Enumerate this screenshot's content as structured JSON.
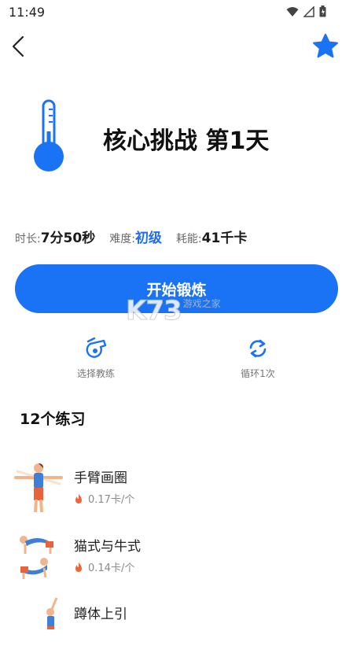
{
  "status_bar": {
    "time": "11:49",
    "icons": [
      "wifi-icon",
      "signal-icon",
      "battery-icon"
    ]
  },
  "header": {
    "back_icon": "chevron-left-icon",
    "favorite_icon": "star-icon"
  },
  "workout": {
    "title": "核心挑战 第1天",
    "icon": "thermometer-icon"
  },
  "stats": {
    "duration_label": "时长:",
    "duration_value": "7分50秒",
    "difficulty_label": "难度:",
    "difficulty_value": "初级",
    "calories_label": "耗能:",
    "calories_value": "41千卡"
  },
  "start_button": "开始锻炼",
  "watermark": {
    "logo": "K73",
    "sub": "游戏之家"
  },
  "tools": {
    "coach_label": "选择教练",
    "loop_label": "循环1次"
  },
  "exercises_title": "12个练习",
  "exercises": [
    {
      "name": "手臂画圈",
      "calories": "0.17卡/个"
    },
    {
      "name": "猫式与牛式",
      "calories": "0.14卡/个"
    },
    {
      "name": "蹲体上引",
      "calories": ""
    }
  ],
  "colors": {
    "accent": "#1a73f5",
    "difficulty": "#1f6ff0",
    "flame": "#f0663a"
  }
}
